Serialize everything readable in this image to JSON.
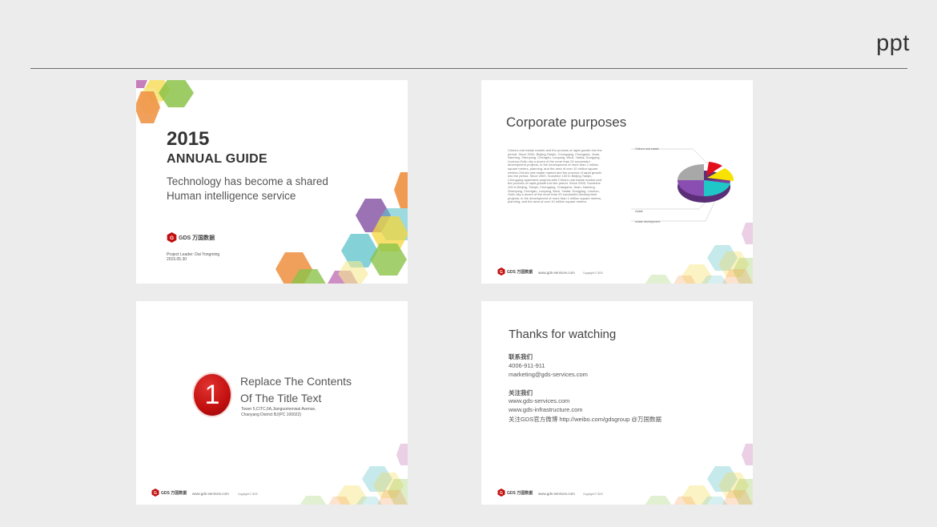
{
  "header": {
    "label": "ppt"
  },
  "colors": {
    "background": "#ececec",
    "brand_red": "#c20f0f",
    "rule": "#6a6a6a",
    "hex_palette": [
      "#ef8f3f",
      "#8cc34a",
      "#f5d63b",
      "#8a5aa8",
      "#5bc1c9",
      "#b85fa9"
    ]
  },
  "slides": [
    {
      "year": "2015",
      "title": "ANNUAL GUIDE",
      "subtitle_line1": "Technology has become a shared",
      "subtitle_line2": "Human intelligence service",
      "logo_text": "GDS 万国数据",
      "project_leader": "Project Leader: Dai Yongming",
      "date": "2015.05.30"
    },
    {
      "title": "Corporate purposes",
      "body": "China's real estate market and the process of rapid growth into the period. Since 2000, Beijing,Tianjin, Chongqing, Changsha, Jinan, Nanning, Shenyang, Chengdu, Luoyang, Wuxi, Yantai, Dongying, Liuzhou,Gulin city a dozen of the more than 20 successful development projects, in the development of more than 1 million square meters, planning, and the area of over 10 million square meters.China's real estate market and the process of rapid growth into the period. Since 2000, Sunshine 100 in Beijing,Tianjin, Chongqing apartment projects,with China's real estate market and the process of rapid growth into the period. Since 2000, Sunshine 100 in Beijing, Tianjin, Chongqing, Changsha, Jinan, Nanning, Shenyang, Chengdu, Luoyang, Wuxi, Yantai, Dongying, Liuzhou, Gulin city a dozen of the more than 20 successful development projects, in the development of more than 1 million square meters, planning, and the area of over 10 million square meters.",
      "pie_label_1": "China's real estate",
      "pie_label_2": "estate",
      "pie_label_3": "estate  development",
      "logo_text": "GDS 万国数据",
      "footer_url": "www.gds-services.com",
      "footer_copy": "Copyright © GDS"
    },
    {
      "number": "1",
      "title_line1": "Replace The Contents",
      "title_line2": "Of The Title Text",
      "address_line1": "Tower 5,CITC,6A,Jianguomenwai Avenue,",
      "address_line2": "Chaoyang District BJ(PC 100022)",
      "logo_text": "GDS 万国数据",
      "footer_url": "www.gds-services.com",
      "footer_copy": "Copyright © GDS"
    },
    {
      "title": "Thanks for watching",
      "contact_heading": "联系我们",
      "phone": "4006-911-911",
      "email": "marketing@gds-services.com",
      "follow_heading": "关注我们",
      "website1": "www.gds-services.com",
      "website2": "www.gds-infrastructure.com",
      "weibo": "关注GDS官方微博 http://weibo.com/gdsgroup @万国数据",
      "logo_text": "GDS 万国数据",
      "footer_url": "www.gds-services.com",
      "footer_copy": "Copyright © GDS"
    }
  ]
}
